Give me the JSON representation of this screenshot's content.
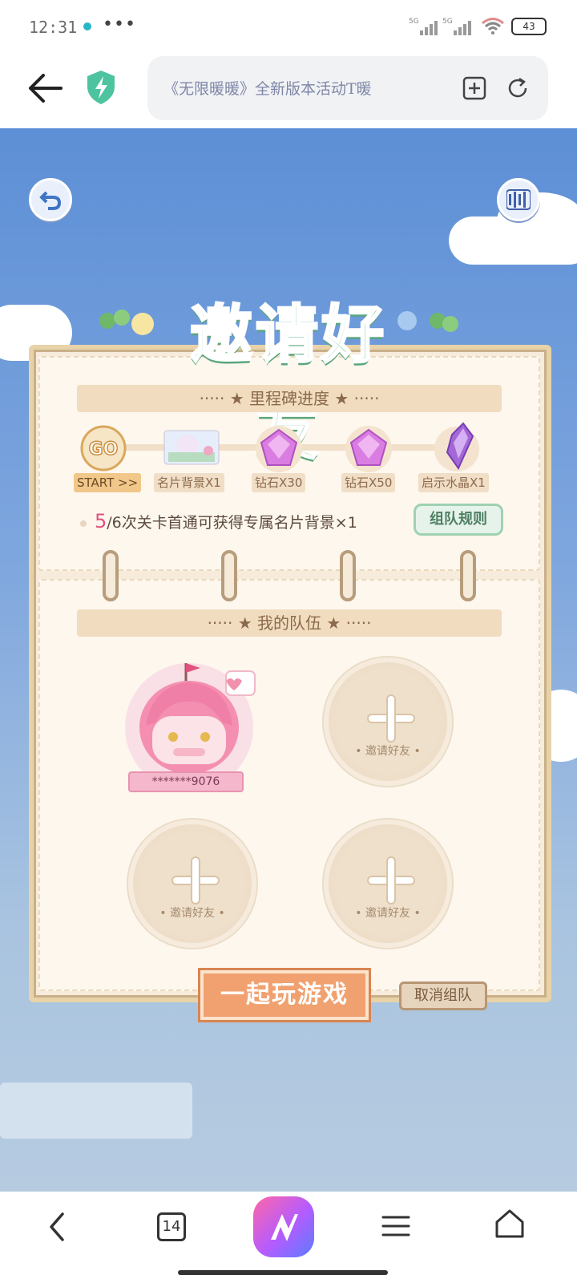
{
  "status_bar": {
    "time": "12:31",
    "more": "•••",
    "net1": "5G",
    "net2": "5G",
    "battery": "43"
  },
  "browser": {
    "url_title": "《无限暖暖》全新版本活动T暖",
    "accent_color": "#4dc3a0"
  },
  "game": {
    "title": "邀请好友",
    "milestone_header": "····· ★ 里程碑进度 ★ ·····",
    "milestones": [
      {
        "icon": "go-badge",
        "label": "START >>"
      },
      {
        "icon": "card-background",
        "label": "名片背景X1"
      },
      {
        "icon": "diamond",
        "label": "钻石X30"
      },
      {
        "icon": "diamond",
        "label": "钻石X50"
      },
      {
        "icon": "crystal",
        "label": "启示水晶X1"
      }
    ],
    "progress_num": "5",
    "progress_text": "/6次关卡首通可获得专属名片背景×1",
    "rule_button": "组队规则",
    "team_header": "····· ★ 我的队伍 ★ ·····",
    "member_name": "*******9076",
    "invite_label": "• 邀请好友 •",
    "play_button": "一起玩游戏",
    "cancel_button": "取消组队"
  },
  "bottom_nav": {
    "tabs_count": "14"
  }
}
